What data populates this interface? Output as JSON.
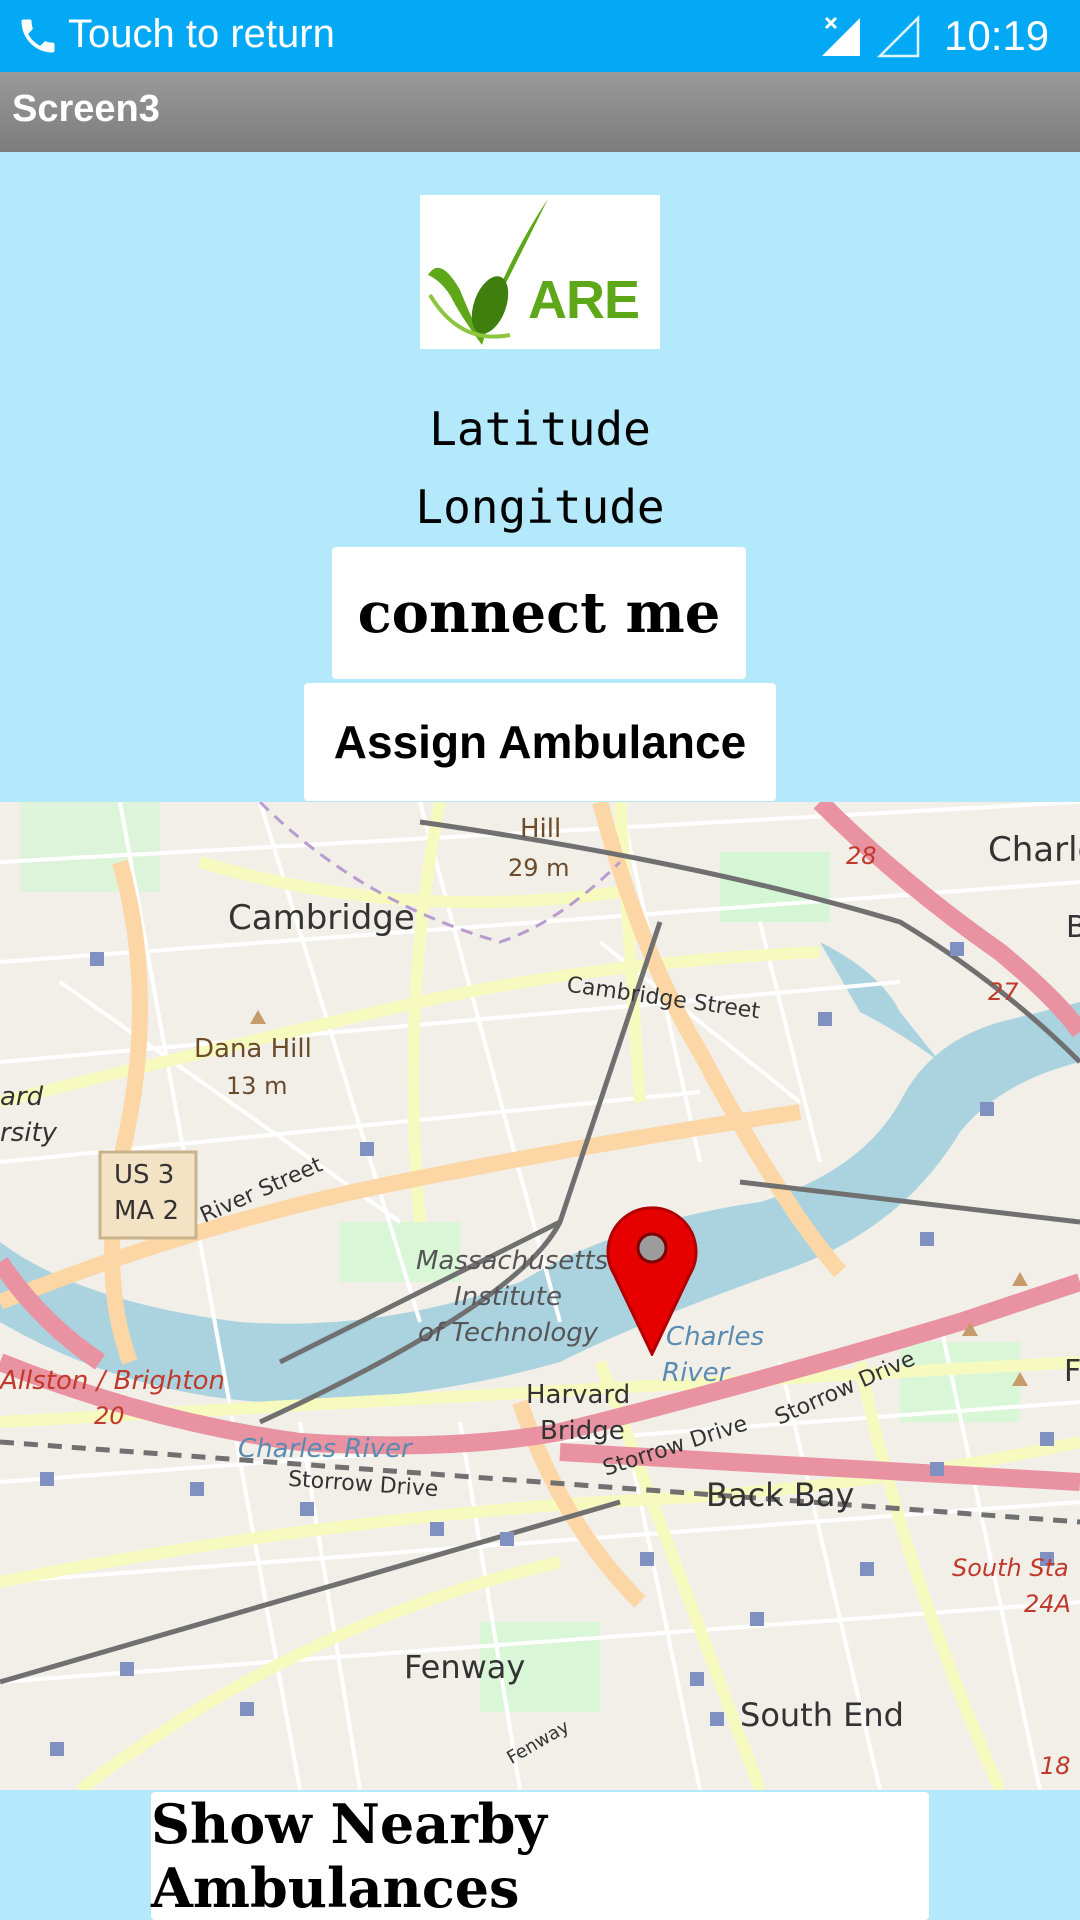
{
  "status_bar": {
    "return_text": "Touch to return",
    "time": "10:19",
    "icons": [
      "phone-icon",
      "signal-icon",
      "signal-empty-icon"
    ]
  },
  "app_bar": {
    "title": "Screen3"
  },
  "logo": {
    "text": "ARE",
    "icon": "checkmark-leaf-icon"
  },
  "location": {
    "latitude_label": "Latitude",
    "longitude_label": "Longitude"
  },
  "buttons": {
    "connect": "connect me",
    "assign": "Assign Ambulance",
    "nearby": "Show Nearby Ambulances"
  },
  "map": {
    "labels": {
      "cambridge": "Cambridge",
      "charle": "Charle",
      "hill": "Hill",
      "hill_elev": "29 m",
      "cambridge_street": "Cambridge Street",
      "dana_hill": "Dana Hill",
      "dana_hill_elev": "13 m",
      "ard": "ard",
      "rsity": "rsity",
      "us3": "US 3",
      "ma2": "MA 2",
      "river_street": "River Street",
      "mit_1": "Massachusetts",
      "mit_2": "Institute",
      "mit_3": "of Technology",
      "charles_river_1": "Charles",
      "charles_river_2": "River",
      "charles_river_w": "Charles River",
      "allston": "Allston / Brighton",
      "allston_num": "20",
      "harvard_1": "Harvard",
      "harvard_2": "Bridge",
      "storrow_w": "Storrow Drive",
      "storrow_e1": "Storrow Drive",
      "storrow_e2": "Storrow Drive",
      "back_bay": "Back Bay",
      "south_sta": "South Sta",
      "num_24a": "24A",
      "fenway": "Fenway",
      "fenway_rd": "Fenway",
      "south_end": "South End",
      "num_28": "28",
      "num_27": "27",
      "num_18": "18",
      "f_edge": "F",
      "b_edge": "B"
    },
    "marker": "map-pin-icon"
  }
}
